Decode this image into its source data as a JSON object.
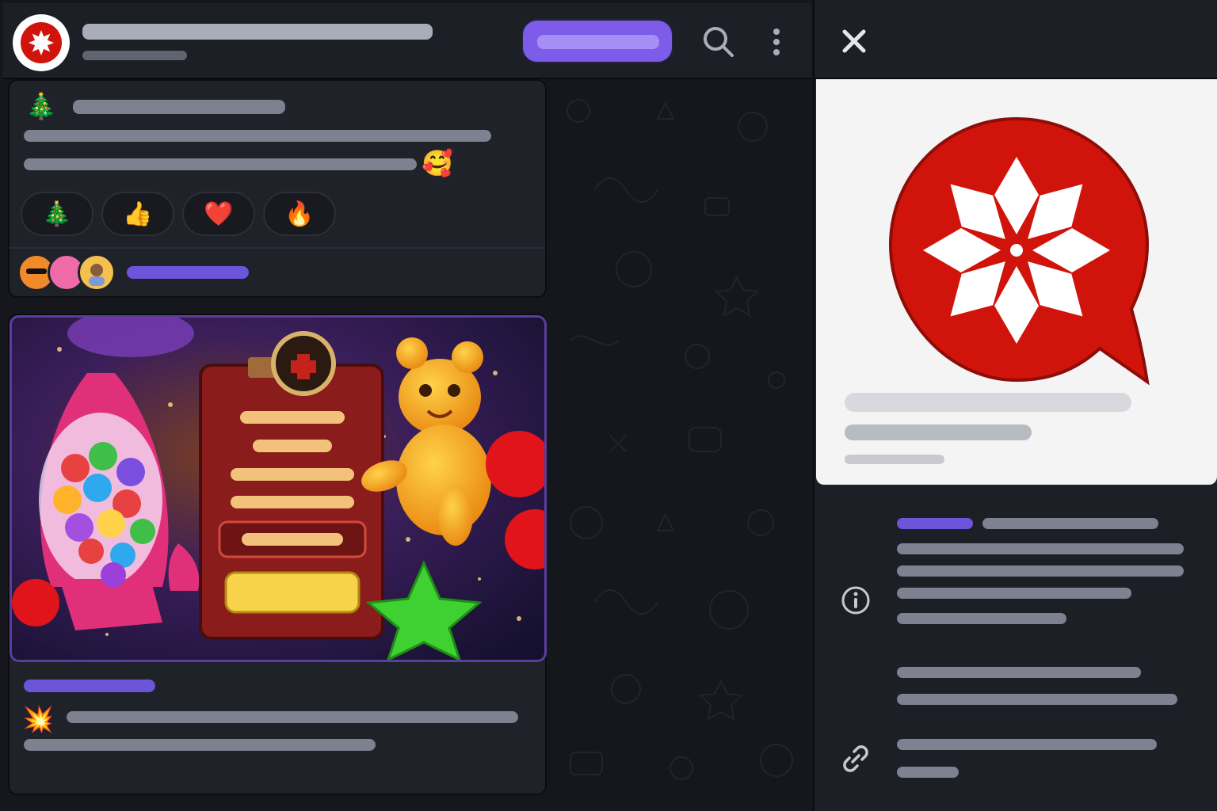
{
  "app": {
    "channel_title": "",
    "channel_subtitle": "",
    "join_label": "",
    "accent": "#7c5ce8"
  },
  "header_icons": [
    "channel-logo-icon",
    "search-icon",
    "more-vertical-icon"
  ],
  "message1": {
    "title_emoji": "🎄",
    "inline_emoji": "🥰",
    "reactions": [
      {
        "emoji": "🎄",
        "icon": "christmas-tree-icon"
      },
      {
        "emoji": "👍",
        "icon": "thumbs-up-icon"
      },
      {
        "emoji": "❤️",
        "icon": "heart-icon"
      },
      {
        "emoji": "🔥",
        "icon": "fire-icon"
      }
    ],
    "comment_count_text": ""
  },
  "message2": {
    "media": "game-promo-image",
    "lead_emoji": "💥"
  },
  "side_panel": {
    "close_icon": "close-icon",
    "info_icon": "info-icon",
    "link_icon": "link-icon",
    "brand_color": "#d0140c"
  }
}
